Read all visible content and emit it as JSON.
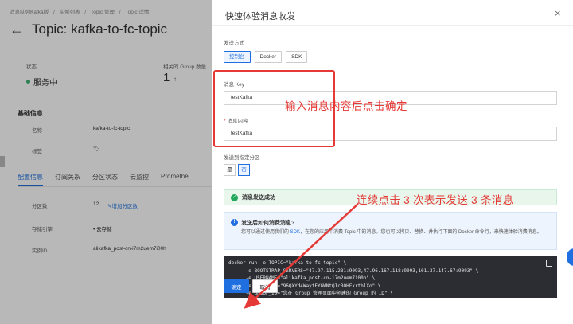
{
  "background": {
    "breadcrumb": [
      "消息队列Kafka版",
      "/",
      "实例列表",
      "/",
      "Topic 管理",
      "/",
      "Topic 详情"
    ],
    "title": "Topic: kafka-to-fc-topic",
    "status_label": "状态",
    "status_value": "服务中",
    "group_label": "相关的 Group 数量",
    "group_count": "1",
    "group_arrow": "↑",
    "section_title": "基础信息",
    "basic": [
      {
        "label": "名称",
        "value": "kafka-to-fc-topic"
      },
      {
        "label": "标签",
        "value": "🏷"
      }
    ],
    "tabs": [
      "配置信息",
      "订阅关系",
      "分区状态",
      "云监控",
      "Promethe"
    ],
    "config": {
      "partition_label": "分区数",
      "partition_value": "12",
      "partition_link": "✎增加分区数",
      "storage_label": "存储引擎",
      "storage_value": "云存储",
      "instance_label": "实例ID",
      "instance_value": "alikafka_post-cn-i7m2uem7i00h"
    }
  },
  "drawer": {
    "title": "快速体验消息收发",
    "close": "×",
    "send_method_label": "发送方式",
    "send_methods": [
      "控制台",
      "Docker",
      "SDK"
    ],
    "key_label": "消息 Key",
    "key_value": "testKafka",
    "content_label": "消息内容",
    "content_value": "testKafka",
    "partition_label": "发送到指定分区",
    "partition_options": [
      "是",
      "否"
    ],
    "confirm": "确定",
    "cancel": "取消"
  },
  "success": {
    "icon": "✓",
    "text": "消息发送成功"
  },
  "info": {
    "icon": "!",
    "title": "发送后如何消费消息?",
    "desc_prefix": "您可以通过使用我们的 ",
    "desc_link": "SDK",
    "desc_suffix": "，在您的应用中消费 Topic 中的消息。您也可以拷贝、替换、并执行下面的 Docker 命令行，来快速体验消费消息。"
  },
  "code_lines": [
    "docker run -e TOPIC=\"kafka-to-fc-topic\" \\",
    "      -e BOOTSTRAP_SERVERS=\"47.97.115.231:9093,47.96.167.118:9093,101.37.147.67:9093\" \\",
    "      -e USERNAME=\"alikafka_post-cn-i7m2uem7i00h\" \\",
    "      -e PASSWORD=\"96QXYd4WaytFYGWNtQIcBOHFkrtblXo\" \\",
    "      -e GROUP_ID=\"您在 Group 管理页面中创建的 Group 的 ID\" \\"
  ],
  "annotations": {
    "main": "输入消息内容后点击确定",
    "second": "连续点击 3 次表示发送 3 条消息"
  },
  "colors": {
    "accent": "#1f6fe0",
    "annotation": "#e53935",
    "success": "#22a85b"
  }
}
